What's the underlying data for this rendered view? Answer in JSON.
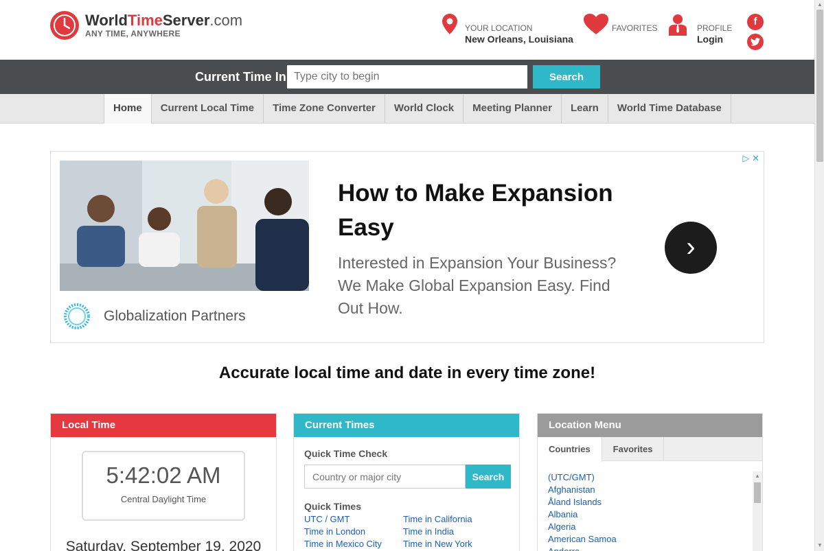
{
  "header": {
    "logo_world": "World",
    "logo_time": "Time",
    "logo_server": "Server",
    "logo_dotcom": ".com",
    "tagline": "ANY TIME, ANYWHERE",
    "location_label": "YOUR LOCATION",
    "location_value": "New Orleans, Louisiana",
    "favorites_label": "FAVORITES",
    "profile_label": "PROFILE",
    "profile_value": "Login"
  },
  "searchbar": {
    "label": "Current Time In",
    "placeholder": "Type city to begin",
    "button": "Search"
  },
  "nav": {
    "items": [
      "Home",
      "Current Local Time",
      "Time Zone Converter",
      "World Clock",
      "Meeting Planner",
      "Learn",
      "World Time Database"
    ]
  },
  "ad": {
    "title": "How to Make Expansion Easy",
    "body": "Interested in Expansion Your Business? We Make Global Expansion Easy. Find Out How.",
    "brand": "Globalization Partners"
  },
  "tagline": "Accurate local time and date in every time zone!",
  "local_time": {
    "header": "Local Time",
    "time": "5:42:02 AM",
    "zone": "Central Daylight Time",
    "date": "Saturday, September 19, 2020"
  },
  "current_times": {
    "header": "Current Times",
    "quick_check_label": "Quick Time Check",
    "input_placeholder": "Country or major city",
    "button": "Search",
    "quick_times_label": "Quick Times",
    "links": [
      "UTC / GMT",
      "Time in California",
      "Time in London",
      "Time in India",
      "Time in Mexico City",
      "Time in New York"
    ]
  },
  "location_menu": {
    "header": "Location Menu",
    "tabs": [
      "Countries",
      "Favorites"
    ],
    "countries": [
      "(UTC/GMT)",
      "Afghanistan",
      "Åland Islands",
      "Albania",
      "Algeria",
      "American Samoa",
      "Andorra"
    ]
  },
  "colors": {
    "brand_red": "#e5383f",
    "teal": "#2fb9c8",
    "dark_bar": "#4a4d4f",
    "grey_header": "#9b9b9b"
  }
}
